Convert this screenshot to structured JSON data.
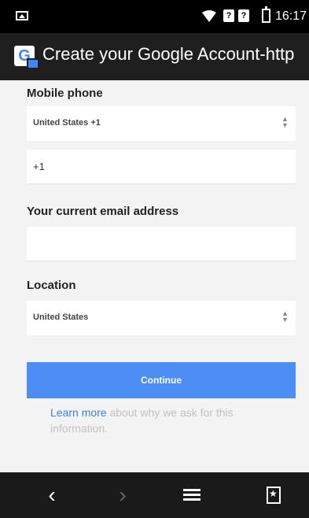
{
  "status_bar": {
    "sim1": "?",
    "sim2": "?",
    "time": "16:17"
  },
  "app_bar": {
    "title": "Create your Google Account-http"
  },
  "form": {
    "mobile_phone": {
      "label": "Mobile phone",
      "country_value": "United States +1",
      "number_value": "+1"
    },
    "email": {
      "label": "Your current email address",
      "value": ""
    },
    "location": {
      "label": "Location",
      "value": "United States"
    },
    "continue_label": "Continue",
    "help": {
      "link_text": "Learn more",
      "rest_text": " about why we ask for this information."
    }
  },
  "nav_bar": {
    "back_icon": "chevron-left-icon",
    "forward_icon": "chevron-right-icon",
    "tabs_icon": "tabs-icon",
    "bookmark_icon": "bookmark-icon"
  },
  "colors": {
    "accent": "#4c8df6",
    "link": "#3f7fe3",
    "form_background": "#f3f3f3"
  }
}
